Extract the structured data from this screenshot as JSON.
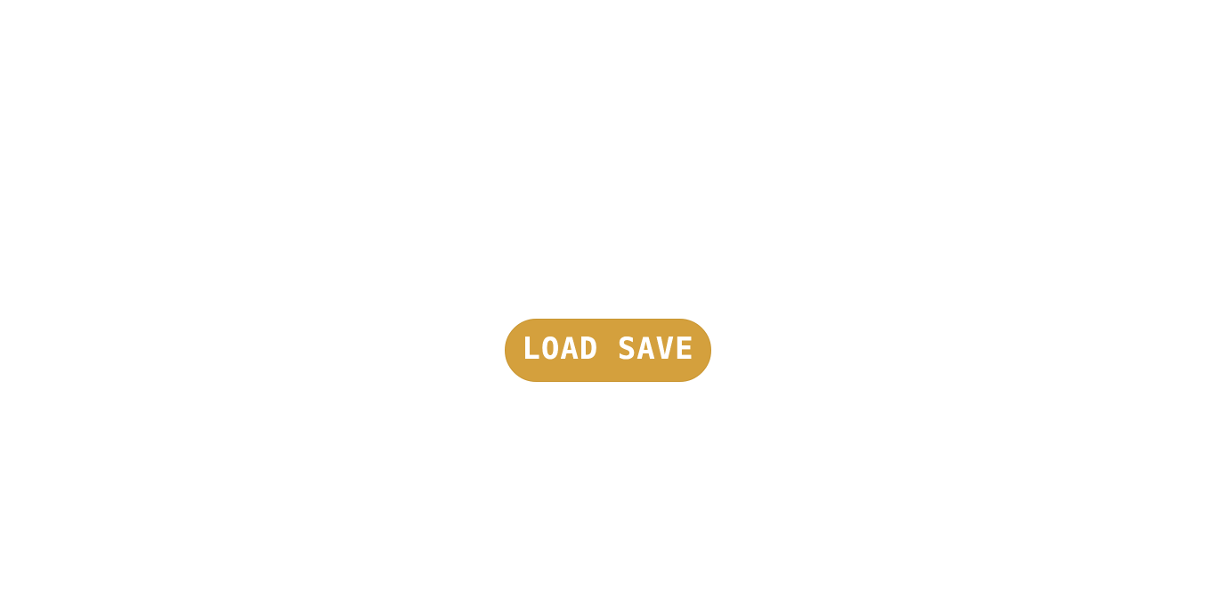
{
  "main": {
    "load_save_label": "LOAD SAVE"
  },
  "colors": {
    "background": "#ffffff",
    "button_fill": "#d4a03d",
    "button_text": "#ffffff"
  }
}
